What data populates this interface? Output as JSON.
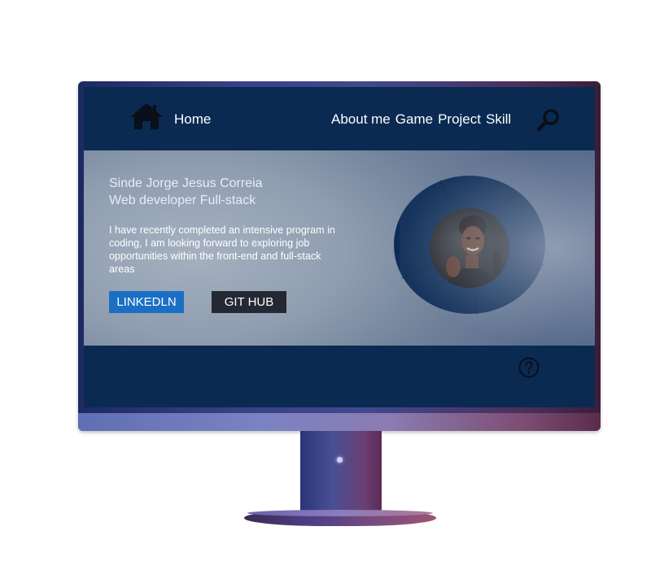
{
  "nav": {
    "home_label": "Home",
    "links": [
      "About me",
      "Game",
      "Project",
      "Skill"
    ],
    "home_icon": "home-icon",
    "search_icon": "search-icon"
  },
  "hero": {
    "name": "Sinde Jorge Jesus Correia",
    "role": "Web developer Full-stack",
    "description": "I have recently completed an intensive program in coding, I am looking forward to exploring job opportunities within the front-end and full-stack areas",
    "buttons": {
      "linkedin": "LINKEDLN",
      "github": "GIT HUB"
    },
    "avatar_icon": "profile-photo"
  },
  "footer": {
    "help_icon": "help-icon"
  },
  "colors": {
    "nav_bg": "#0a2a52",
    "linkedin": "#1a6fc4",
    "github": "#242832",
    "avatar_ring": "#0b2b55"
  }
}
